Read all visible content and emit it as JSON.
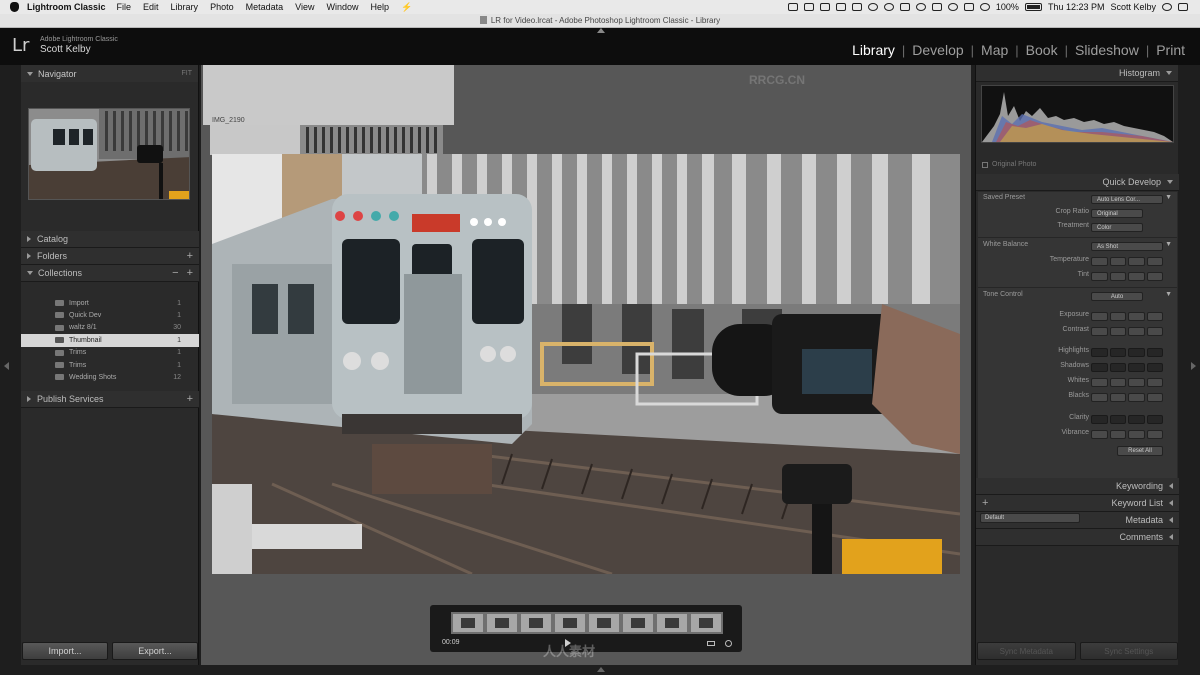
{
  "menubar": {
    "app_name": "Lightroom Classic",
    "items": [
      "File",
      "Edit",
      "Library",
      "Photo",
      "Metadata",
      "View",
      "Window",
      "Help"
    ],
    "battery": "100%",
    "clock": "Thu 12:23 PM",
    "user": "Scott Kelby"
  },
  "window": {
    "title": "LR for Video.lrcat - Adobe Photoshop Lightroom Classic - Library"
  },
  "identity": {
    "logo": "Lr",
    "product": "Adobe Lightroom Classic",
    "user": "Scott Kelby"
  },
  "modules": {
    "items": [
      "Library",
      "Develop",
      "Map",
      "Book",
      "Slideshow",
      "Print"
    ],
    "active": "Library",
    "separator": "|"
  },
  "left_panel": {
    "navigator": {
      "title": "Navigator",
      "fit": "FIT"
    },
    "catalog": "Catalog",
    "folders": "Folders",
    "collections": {
      "title": "Collections",
      "items": [
        {
          "name": "Import",
          "count": "1"
        },
        {
          "name": "Quick Dev",
          "count": "1"
        },
        {
          "name": "waltz 8/1",
          "count": "30"
        },
        {
          "name": "Thumbnail",
          "count": "1"
        },
        {
          "name": "Trims",
          "count": "1"
        },
        {
          "name": "Trims",
          "count": "1"
        },
        {
          "name": "Wedding Shots",
          "count": "12"
        }
      ],
      "selected_index": 3
    },
    "publish_services": "Publish Services",
    "import_button": "Import...",
    "export_button": "Export..."
  },
  "center": {
    "thumb_label": "IMG_2190",
    "watermark_top": "RRCG.CN",
    "film_time": "00:09",
    "watermark_bottom": "人人素材"
  },
  "right_panel": {
    "histogram": "Histogram",
    "original_photo": "Original Photo",
    "quick_develop": {
      "title": "Quick Develop",
      "saved_preset_label": "Saved Preset",
      "saved_preset_value": "Auto Lens Cor...",
      "crop_ratio_label": "Crop Ratio",
      "crop_ratio_value": "Original",
      "treatment_label": "Treatment",
      "treatment_value": "Color",
      "white_balance_label": "White Balance",
      "white_balance_value": "As Shot",
      "temperature_label": "Temperature",
      "tint_label": "Tint",
      "tone_control_label": "Tone Control",
      "tone_control_value": "Auto",
      "exposure_label": "Exposure",
      "contrast_label": "Contrast",
      "highlights_label": "Highlights",
      "shadows_label": "Shadows",
      "whites_label": "Whites",
      "blacks_label": "Blacks",
      "clarity_label": "Clarity",
      "vibrance_label": "Vibrance",
      "reset_all": "Reset All"
    },
    "keywording": "Keywording",
    "keyword_list": "Keyword List",
    "metadata": "Metadata",
    "metadata_preset": "Default",
    "comments": "Comments",
    "sync_metadata": "Sync Metadata",
    "sync_settings": "Sync Settings"
  },
  "colors": {
    "accent_active_module": "#ffffff",
    "panel_background": "#2a2a2a",
    "selected_row": "#d6d6d6"
  }
}
